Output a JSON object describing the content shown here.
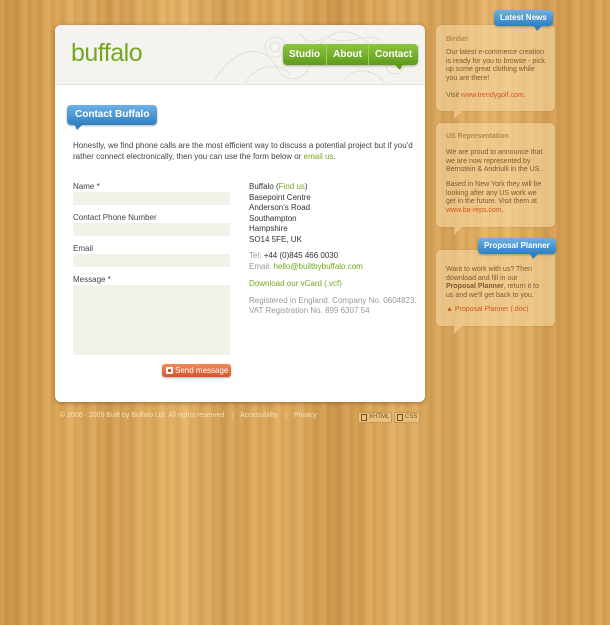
{
  "logo": "buffalo",
  "nav": {
    "items": [
      "Studio",
      "About",
      "Contact"
    ]
  },
  "page_title": "Contact Buffalo",
  "intro": {
    "text": "Honestly, we find phone calls are the most efficient way to discuss a potential project but if you'd rather connect electronically, then you can use the form below or ",
    "link": "email us",
    "end": "."
  },
  "form": {
    "name_label": "Name *",
    "phone_label": "Contact Phone Number",
    "email_label": "Email",
    "message_label": "Message *",
    "name_value": "",
    "phone_value": "",
    "email_value": "",
    "message_value": "",
    "send_label": "Send message"
  },
  "address": {
    "company": "Buffalo (",
    "find_us": "Find us",
    "company_end": ")",
    "lines": [
      "Basepoint Centre",
      "Anderson's Road",
      "Southampton",
      "Hampshire",
      "SO14 5FE, UK"
    ],
    "tel_label": "Tel:",
    "tel_value": "+44 (0)845 466 0030",
    "email_label": "Email:",
    "email_value": "hello@builtbybuffalo.com",
    "vcard": "Download our vCard (.vcf)",
    "registered": "Registered in England. Company No. 0604823.",
    "vat": "VAT Registration No. 899 6307 54"
  },
  "footer": {
    "copyright": "© 2006 - 2009 Built by Buffalo Ltd. All rights reserved",
    "accessibility": "Accessibility",
    "privacy": "Privacy",
    "badge_xhtml": "XHTML",
    "badge_css": "CSS"
  },
  "sidebar": {
    "latest_news_tag": "Latest News",
    "news1_title": "Birdie!",
    "news1_text": "Our latest e-commerce creation is ready for you to browse - pick up some great clothing while you are there!",
    "news1_visit": "Visit ",
    "news1_link": "www.trendygolf.com",
    "news1_end": ".",
    "news2_title": "US Representation",
    "news2_text1": "We are proud to announce that we are now represented by Bernstein & Andriulli in the US.",
    "news2_text2": "Based in New York they will be looking after any US work we get in the future. Visit them at ",
    "news2_link": "www.ba-reps.com",
    "news2_end": ".",
    "planner_tag": "Proposal Planner",
    "planner_text_a": "Want to work with us? Then download and fill in our ",
    "planner_bold": "Proposal Planner",
    "planner_text_b": ", return it to us and we'll get back to you.",
    "planner_link": "Proposal Planner (.doc)"
  },
  "colors": {
    "green": "#73a81e",
    "blue": "#2f7fc1",
    "orange": "#d4551f"
  }
}
